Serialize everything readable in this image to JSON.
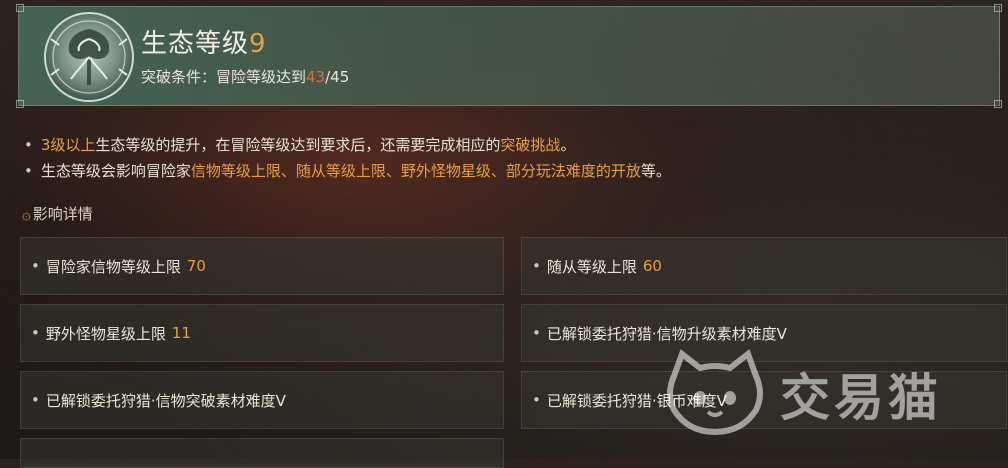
{
  "header": {
    "title": "生态等级",
    "level": "9",
    "breakthrough_label": "突破条件：冒险等级达到",
    "current_level": "43",
    "required_level": "/45"
  },
  "notes": [
    {
      "parts": [
        "3级以上",
        "生态等级的提升，在冒险等级达到要求后，还需要完成相应的",
        "突破挑战",
        "。"
      ]
    },
    {
      "parts": [
        "生态等级会影响冒险家",
        "信物等级上限、随从等级上限、野外怪物星级、部分玩法难度的开放",
        "等。"
      ]
    }
  ],
  "section": {
    "deco_glyph": "۞",
    "title": "影响详情"
  },
  "effects": [
    {
      "label": "冒险家信物等级上限",
      "value": "70"
    },
    {
      "label": "随从等级上限",
      "value": "60"
    },
    {
      "label": "野外怪物星级上限",
      "value": "11"
    },
    {
      "label": "已解锁委托狩猎·信物升级素材难度Ⅴ",
      "value": ""
    },
    {
      "label": "已解锁委托狩猎·信物突破素材难度Ⅴ",
      "value": ""
    },
    {
      "label": "已解锁委托狩猎·银币难度Ⅴ",
      "value": ""
    }
  ],
  "watermark": {
    "text": "交易猫"
  },
  "colors": {
    "accent": "#e7a13f",
    "current_level": "#e46a3c",
    "header_bg": "#46695a"
  }
}
